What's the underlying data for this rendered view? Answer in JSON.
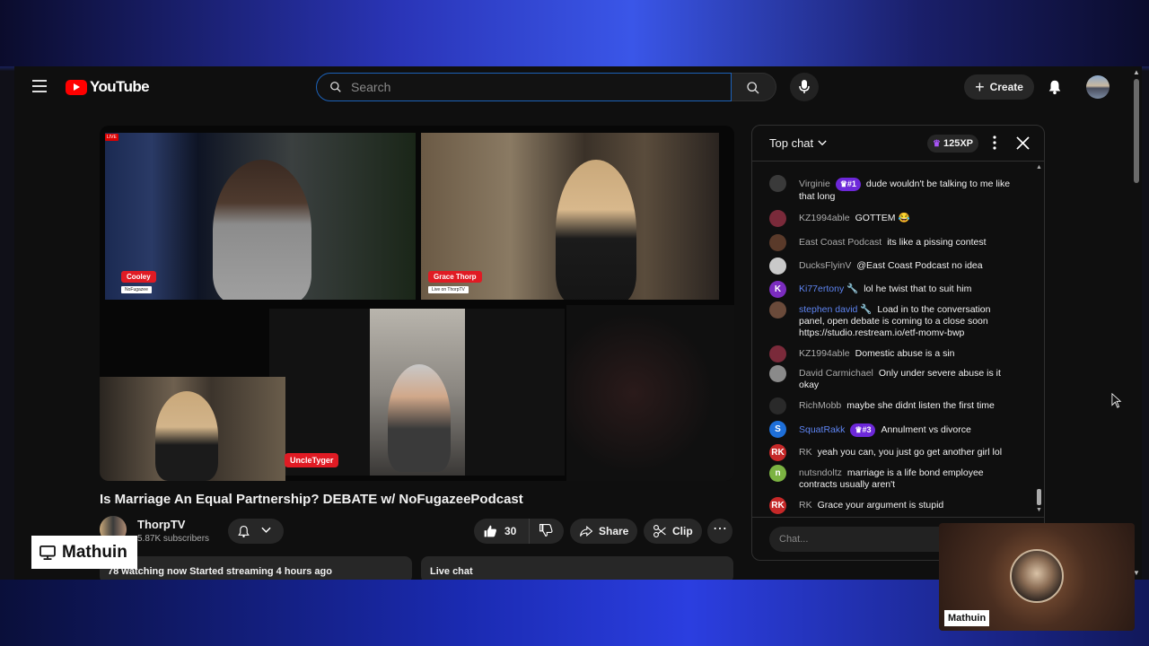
{
  "header": {
    "logo_text": "YouTube",
    "search_placeholder": "Search",
    "create_label": "Create"
  },
  "video": {
    "title": "Is Marriage An Equal Partnership? DEBATE w/ NoFugazeePodcast",
    "overlays": {
      "live": "LIVE",
      "cooley_name": "Cooley",
      "cooley_sub": "NoFugazee",
      "grace_name": "Grace Thorp",
      "grace_sub": "Live on ThorpTV",
      "uncle_name": "UncleTyger"
    }
  },
  "channel": {
    "name": "ThorpTV",
    "subscribers": "5.87K subscribers"
  },
  "actions": {
    "like_count": "30",
    "share_label": "Share",
    "clip_label": "Clip"
  },
  "description": {
    "summary": "78 watching now  Started streaming 4 hours ago"
  },
  "live_chat_box": {
    "label": "Live chat"
  },
  "chat": {
    "mode": "Top chat",
    "xp": "125XP",
    "input_placeholder": "Chat...",
    "messages": [
      {
        "author": "Virginie",
        "badge": "#1",
        "text": "dude wouldn't be talking to me like that long",
        "avatar_color": "#3a3a3a",
        "avatar_text": ""
      },
      {
        "author": "KZ1994able",
        "text": "GOTTEM 😂",
        "avatar_color": "#7a2a3a",
        "avatar_text": ""
      },
      {
        "author": "East Coast Podcast",
        "text": "its like a pissing contest",
        "avatar_color": "#5a3a2a",
        "avatar_text": ""
      },
      {
        "author": "DucksFlyinV",
        "text": "@East Coast Podcast no idea",
        "avatar_color": "#c9c9c9",
        "avatar_text": ""
      },
      {
        "author": "Ki77ertony",
        "mod": true,
        "text": "lol he twist that to suit him",
        "avatar_color": "#7b2cbf",
        "avatar_text": "K"
      },
      {
        "author": "stephen david",
        "mod": true,
        "text": "Load in to the conversation panel, open debate is coming to a close soon https://studio.restream.io/etf-momv-bwp",
        "avatar_color": "#6a4a3a",
        "avatar_text": ""
      },
      {
        "author": "KZ1994able",
        "text": "Domestic abuse is a sin",
        "avatar_color": "#7a2a3a",
        "avatar_text": ""
      },
      {
        "author": "David Carmichael",
        "text": "Only under severe abuse is it okay",
        "avatar_color": "#8a8a8a",
        "avatar_text": ""
      },
      {
        "author": "RichMobb",
        "text": "maybe she didnt listen the first time",
        "avatar_color": "#2a2a2a",
        "avatar_text": ""
      },
      {
        "author": "SquatRakk",
        "badge": "#3",
        "text": "Annulment vs divorce",
        "avatar_color": "#1e6fd9",
        "avatar_text": "S"
      },
      {
        "author": "RK",
        "text": "yeah you can, you just go get another girl lol",
        "avatar_color": "#c62828",
        "avatar_text": "RK"
      },
      {
        "author": "nutsndoltz",
        "text": "marriage is a life bond employee contracts usually aren't",
        "avatar_color": "#7cb342",
        "avatar_text": "n"
      },
      {
        "author": "RK",
        "text": "Grace your argument is stupid",
        "avatar_color": "#c62828",
        "avatar_text": "RK"
      }
    ]
  },
  "streamer_overlay": {
    "label": "Mathuin",
    "cam_name": "Mathuin"
  }
}
